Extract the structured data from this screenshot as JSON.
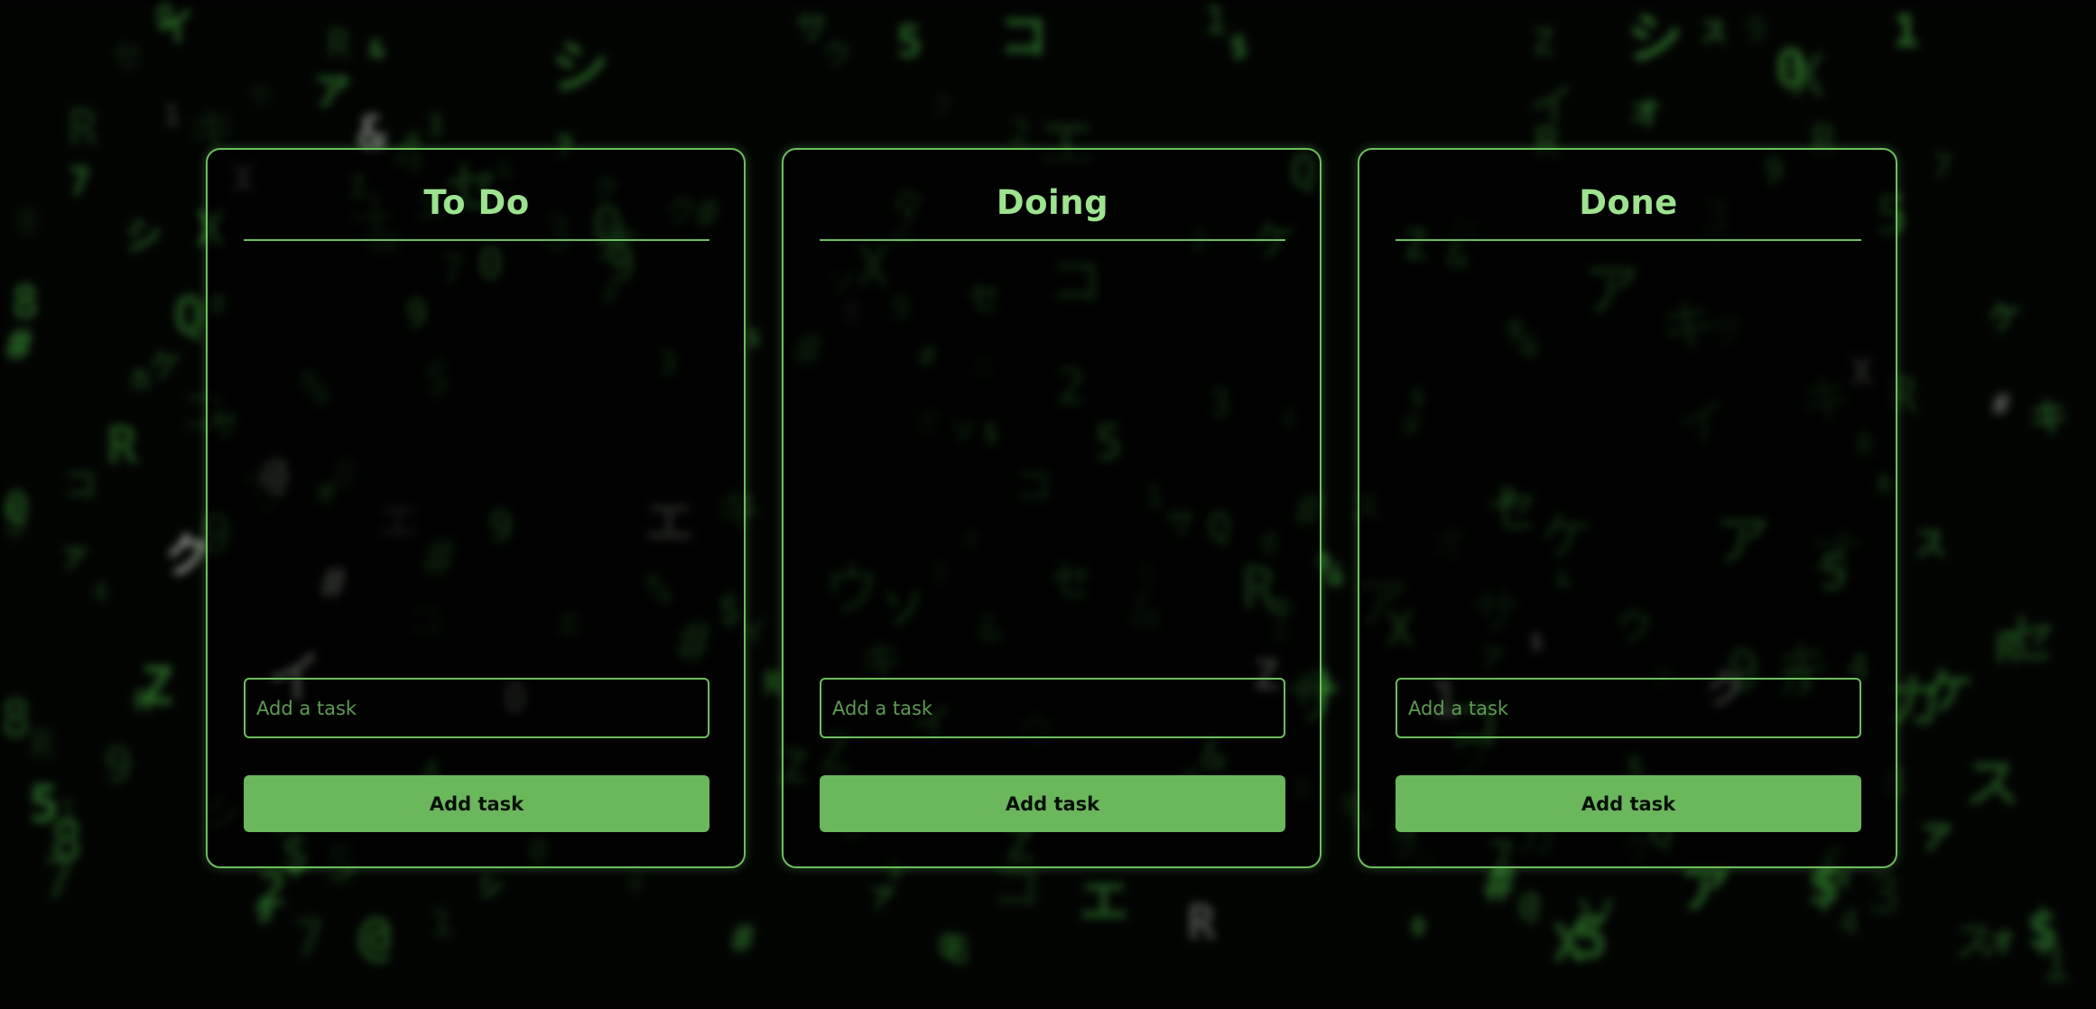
{
  "columns": [
    {
      "title": "To Do",
      "input_placeholder": "Add a task",
      "button_label": "Add task",
      "tasks": []
    },
    {
      "title": "Doing",
      "input_placeholder": "Add a task",
      "button_label": "Add task",
      "tasks": []
    },
    {
      "title": "Done",
      "input_placeholder": "Add a task",
      "button_label": "Add task",
      "tasks": []
    }
  ],
  "theme": {
    "accent": "#6cbf5e",
    "title_color": "#9de38f",
    "button_bg": "#6ab75c",
    "background": "#000000"
  }
}
